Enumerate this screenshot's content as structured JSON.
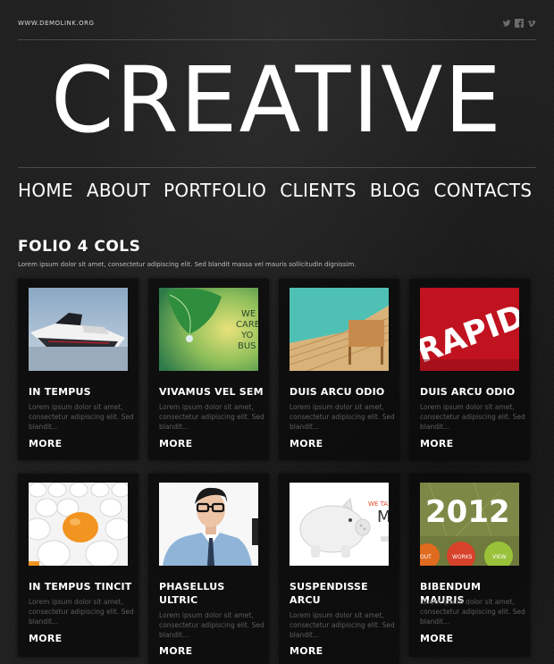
{
  "header": {
    "site_url": "WWW.DEMOLINK.ORG",
    "social": [
      "twitter-icon",
      "facebook-icon",
      "vimeo-icon"
    ],
    "logo": "CREATIVE"
  },
  "nav": {
    "items": [
      "HOME",
      "ABOUT",
      "PORTFOLIO",
      "CLIENTS",
      "BLOG",
      "CONTACTS"
    ]
  },
  "main": {
    "title": "FOLIO 4 COLS",
    "intro": "Lorem ipsum dolor sit amet, consectetur adipiscing elit. Sed blandit massa vel mauris sollicitudin dignissim.",
    "items": [
      {
        "title": "IN TEMPUS",
        "desc": "Lorem ipsum dolor sit amet, consectetur adipiscing elit. Sed blandit...",
        "more": "MORE",
        "image": "jet-ski-boat"
      },
      {
        "title": "VIVAMUS VEL SEM",
        "desc": "Lorem ipsum dolor sit amet, consectetur adipiscing elit. Sed blandit...",
        "more": "MORE",
        "image": "green-leaf-we-care"
      },
      {
        "title": "DUIS ARCU ODIO",
        "desc": "Lorem ipsum dolor sit amet, consectetur adipiscing elit. Sed blandit...",
        "more": "MORE",
        "image": "pool-deck"
      },
      {
        "title": "DUIS ARCU ODIO",
        "desc": "Lorem ipsum dolor sit amet, consectetur adipiscing elit. Sed blandit...",
        "more": "MORE",
        "image": "rapid-red-poster"
      },
      {
        "title": "IN TEMPUS TINCIT",
        "desc": "Lorem ipsum dolor sit amet, consectetur adipiscing elit. Sed blandit...",
        "more": "MORE",
        "image": "eggs-orange-ball"
      },
      {
        "title": "PHASELLUS ULTRIC",
        "desc": "Lorem ipsum dolor sit amet, consectetur adipiscing elit. Sed blandit...",
        "more": "MORE",
        "image": "man-with-glasses"
      },
      {
        "title": "SUSPENDISSE ARCU",
        "desc": "Lorem ipsum dolor sit amet, consectetur adipiscing elit. Sed blandit...",
        "more": "MORE",
        "image": "piggy-bank"
      },
      {
        "title": "BIBENDUM MAURIS",
        "desc": "Lorem ipsum dolor sit amet, consectetur adipiscing elit. Sed blandit...",
        "more": "MORE",
        "image": "calendar-2012"
      }
    ],
    "thumb_texts": {
      "we_care": [
        "WE",
        "CARE",
        "YO",
        "BUS"
      ],
      "rapid": "RAPID",
      "we_ta": "WE TA",
      "m": "M",
      "year": "2012",
      "circles": [
        "OUT",
        "WORKS",
        "VIEW"
      ]
    }
  },
  "colors": {
    "background": "#202020",
    "text": "#ffffff",
    "muted_text": "#5e5e5e",
    "card_bg": "#0a0a0a"
  }
}
